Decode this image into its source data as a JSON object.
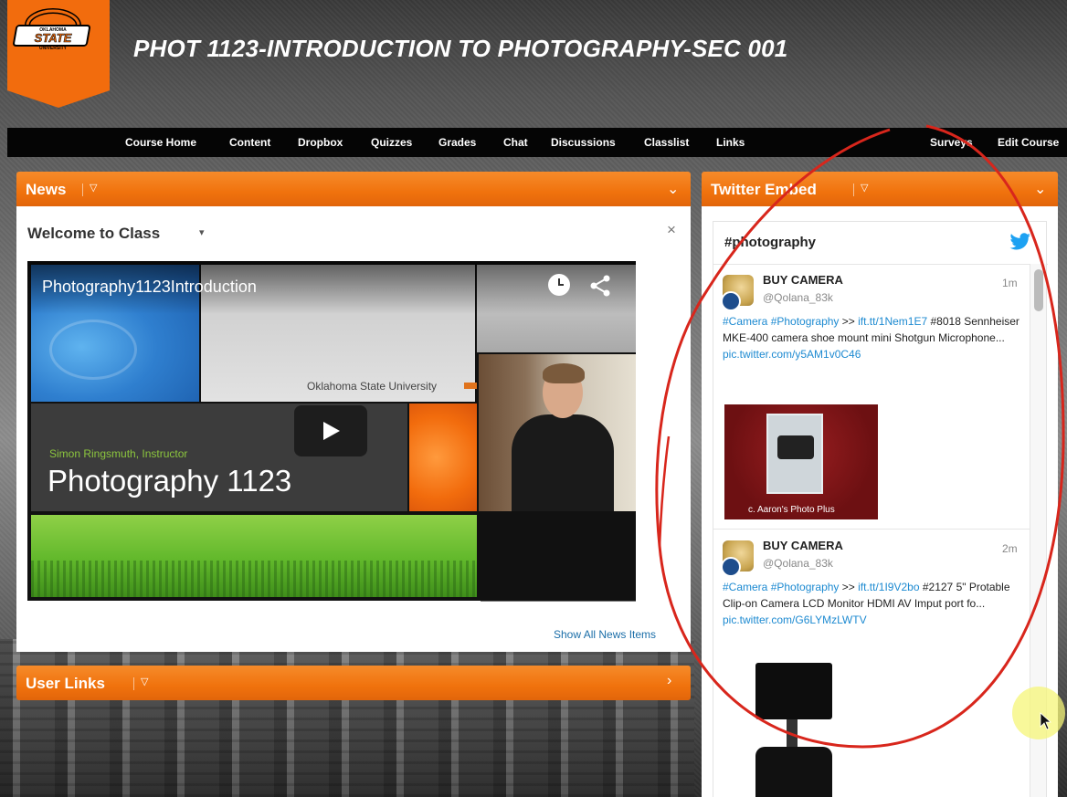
{
  "header": {
    "course_title": "PHOT 1123-INTRODUCTION TO PHOTOGRAPHY-SEC 001",
    "logo": {
      "text_top": "OKLAHOMA",
      "text_main": "STATE",
      "text_bottom": "UNIVERSITY"
    }
  },
  "nav": {
    "items": [
      "Course Home",
      "Content",
      "Dropbox",
      "Quizzes",
      "Grades",
      "Chat",
      "Discussions",
      "Classlist",
      "Links"
    ],
    "right_items": [
      "Surveys",
      "Edit Course"
    ]
  },
  "news": {
    "title": "News",
    "item_title": "Welcome to Class",
    "video": {
      "title": "Photography1123Introduction",
      "university": "Oklahoma State University",
      "instructor": "Simon Ringsmuth, Instructor",
      "course_name": "Photography 1123"
    },
    "show_all": "Show All News Items"
  },
  "user_links": {
    "title": "User Links"
  },
  "twitter": {
    "title": "Twitter Embed",
    "hashtag": "#photography",
    "tweets": [
      {
        "name": "BUY CAMERA",
        "handle": "@Qolana_83k",
        "time": "1m",
        "tags": "#Camera #Photography",
        "arrow": ">>",
        "link1": "ift.tt/1Nem1E7",
        "body": "#8018 Sennheiser MKE-400 camera shoe mount mini Shotgun Microphone...",
        "link2": "pic.twitter.com/y5AM1v0C46",
        "image_caption": "c. Aaron's Photo Plus"
      },
      {
        "name": "BUY CAMERA",
        "handle": "@Qolana_83k",
        "time": "2m",
        "tags": "#Camera #Photography",
        "arrow": ">>",
        "link1": "ift.tt/1I9V2bo",
        "body": "#2127 5\" Protable Clip-on Camera LCD Monitor HDMI AV Imput port fo...",
        "link2": "pic.twitter.com/G6LYMzLWTV"
      }
    ]
  },
  "colors": {
    "accent_orange": "#f0720d",
    "nav_bg": "#050505",
    "link_blue": "#1d8ad1",
    "annotation_red": "#d8261c"
  }
}
